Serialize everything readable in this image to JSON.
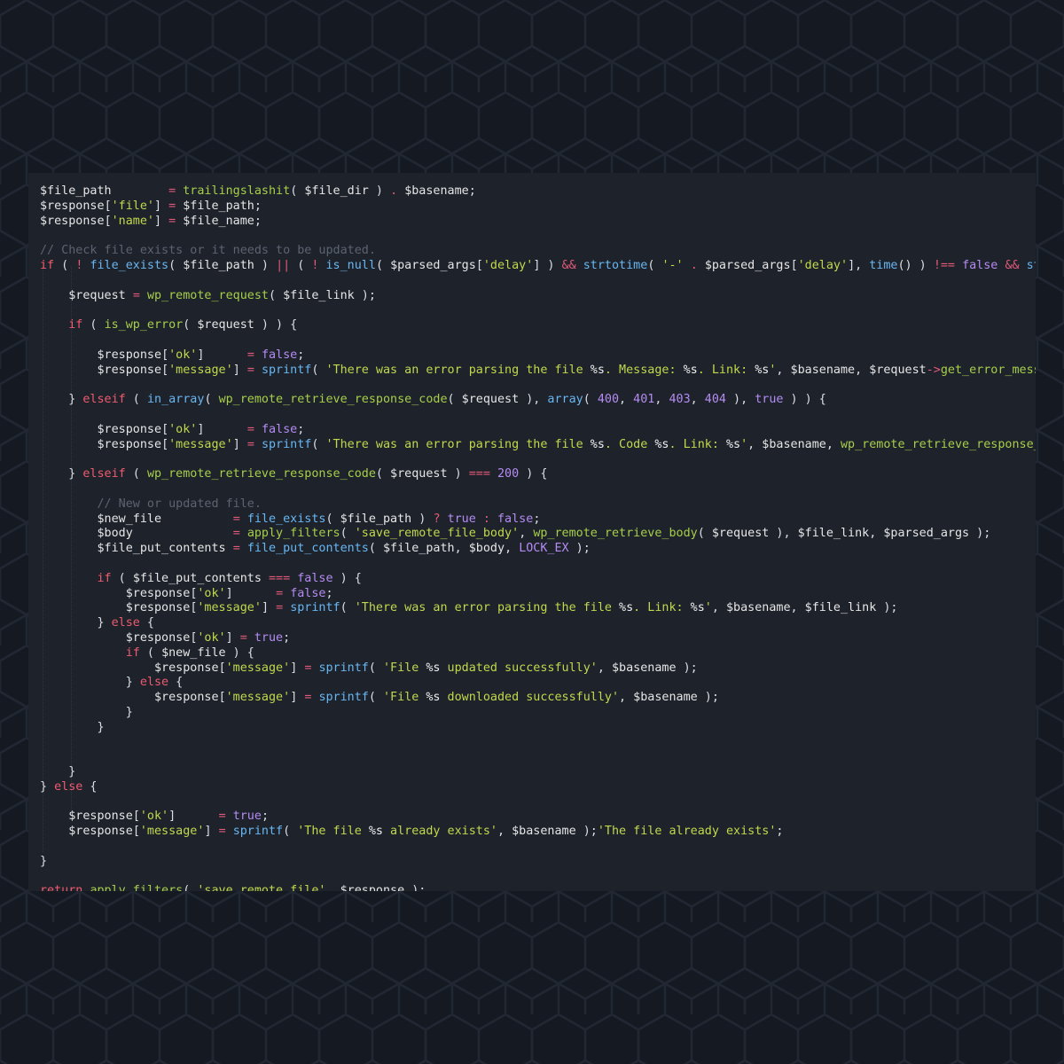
{
  "colors": {
    "background": "#151a22",
    "editor_background": "#1e222b",
    "hex_lines": "#212731",
    "string": "#c2d94c",
    "function": "#68b7f2",
    "keyword": "#ef5a6f",
    "operator": "#e35a79",
    "number": "#b48cf2",
    "comment": "#5c6370",
    "variable": "#e6e6e6"
  },
  "code_lines": [
    [
      [
        "var",
        "$file_path"
      ],
      [
        "txt",
        "        "
      ],
      [
        "op",
        "="
      ],
      [
        "txt",
        " "
      ],
      [
        "fnw",
        "trailingslashit"
      ],
      [
        "txt",
        "( "
      ],
      [
        "var",
        "$file_dir"
      ],
      [
        "txt",
        " ) "
      ],
      [
        "op",
        "."
      ],
      [
        "txt",
        " "
      ],
      [
        "var",
        "$basename"
      ],
      [
        "txt",
        ";"
      ]
    ],
    [
      [
        "var",
        "$response"
      ],
      [
        "txt",
        "["
      ],
      [
        "str",
        "'file'"
      ],
      [
        "txt",
        "] "
      ],
      [
        "op",
        "="
      ],
      [
        "txt",
        " "
      ],
      [
        "var",
        "$file_path"
      ],
      [
        "txt",
        ";"
      ]
    ],
    [
      [
        "var",
        "$response"
      ],
      [
        "txt",
        "["
      ],
      [
        "str",
        "'name'"
      ],
      [
        "txt",
        "] "
      ],
      [
        "op",
        "="
      ],
      [
        "txt",
        " "
      ],
      [
        "var",
        "$file_name"
      ],
      [
        "txt",
        ";"
      ]
    ],
    [],
    [
      [
        "com",
        "// Check file exists or it needs to be updated."
      ]
    ],
    [
      [
        "kw",
        "if"
      ],
      [
        "txt",
        " ( "
      ],
      [
        "op",
        "!"
      ],
      [
        "txt",
        " "
      ],
      [
        "fn",
        "file_exists"
      ],
      [
        "txt",
        "( "
      ],
      [
        "var",
        "$file_path"
      ],
      [
        "txt",
        " ) "
      ],
      [
        "op",
        "||"
      ],
      [
        "txt",
        " ( "
      ],
      [
        "op",
        "!"
      ],
      [
        "txt",
        " "
      ],
      [
        "fn",
        "is_null"
      ],
      [
        "txt",
        "( "
      ],
      [
        "var",
        "$parsed_args"
      ],
      [
        "txt",
        "["
      ],
      [
        "str",
        "'delay'"
      ],
      [
        "txt",
        "] ) "
      ],
      [
        "op",
        "&&"
      ],
      [
        "txt",
        " "
      ],
      [
        "fn",
        "strtotime"
      ],
      [
        "txt",
        "( "
      ],
      [
        "str",
        "'-'"
      ],
      [
        "txt",
        " "
      ],
      [
        "op",
        "."
      ],
      [
        "txt",
        " "
      ],
      [
        "var",
        "$parsed_args"
      ],
      [
        "txt",
        "["
      ],
      [
        "str",
        "'delay'"
      ],
      [
        "txt",
        "], "
      ],
      [
        "fn",
        "time"
      ],
      [
        "txt",
        "() ) "
      ],
      [
        "op",
        "!=="
      ],
      [
        "txt",
        " "
      ],
      [
        "bool",
        "false"
      ],
      [
        "txt",
        " "
      ],
      [
        "op",
        "&&"
      ],
      [
        "txt",
        " "
      ],
      [
        "fn",
        "str"
      ]
    ],
    [],
    [
      [
        "txt",
        "    "
      ],
      [
        "var",
        "$request"
      ],
      [
        "txt",
        " "
      ],
      [
        "op",
        "="
      ],
      [
        "txt",
        " "
      ],
      [
        "fnw",
        "wp_remote_request"
      ],
      [
        "txt",
        "( "
      ],
      [
        "var",
        "$file_link"
      ],
      [
        "txt",
        " );"
      ]
    ],
    [],
    [
      [
        "txt",
        "    "
      ],
      [
        "kw",
        "if"
      ],
      [
        "txt",
        " ( "
      ],
      [
        "fnw",
        "is_wp_error"
      ],
      [
        "txt",
        "( "
      ],
      [
        "var",
        "$request"
      ],
      [
        "txt",
        " ) ) {"
      ]
    ],
    [],
    [
      [
        "txt",
        "        "
      ],
      [
        "var",
        "$response"
      ],
      [
        "txt",
        "["
      ],
      [
        "str",
        "'ok'"
      ],
      [
        "txt",
        "]      "
      ],
      [
        "op",
        "="
      ],
      [
        "txt",
        " "
      ],
      [
        "bool",
        "false"
      ],
      [
        "txt",
        ";"
      ]
    ],
    [
      [
        "txt",
        "        "
      ],
      [
        "var",
        "$response"
      ],
      [
        "txt",
        "["
      ],
      [
        "str",
        "'message'"
      ],
      [
        "txt",
        "] "
      ],
      [
        "op",
        "="
      ],
      [
        "txt",
        " "
      ],
      [
        "fn",
        "sprintf"
      ],
      [
        "txt",
        "( "
      ],
      [
        "str",
        "'There was an error parsing the file "
      ],
      [
        "fmt",
        "%s"
      ],
      [
        "str",
        ". Message: "
      ],
      [
        "fmt",
        "%s"
      ],
      [
        "str",
        ". Link: "
      ],
      [
        "fmt",
        "%s"
      ],
      [
        "str",
        "'"
      ],
      [
        "txt",
        ", "
      ],
      [
        "var",
        "$basename"
      ],
      [
        "txt",
        ", "
      ],
      [
        "var",
        "$request"
      ],
      [
        "op",
        "->"
      ],
      [
        "fnw",
        "get_error_messa"
      ]
    ],
    [],
    [
      [
        "txt",
        "    } "
      ],
      [
        "kw",
        "elseif"
      ],
      [
        "txt",
        " ( "
      ],
      [
        "fn",
        "in_array"
      ],
      [
        "txt",
        "( "
      ],
      [
        "fnw",
        "wp_remote_retrieve_response_code"
      ],
      [
        "txt",
        "( "
      ],
      [
        "var",
        "$request"
      ],
      [
        "txt",
        " ), "
      ],
      [
        "fn",
        "array"
      ],
      [
        "txt",
        "( "
      ],
      [
        "num",
        "400"
      ],
      [
        "txt",
        ", "
      ],
      [
        "num",
        "401"
      ],
      [
        "txt",
        ", "
      ],
      [
        "num",
        "403"
      ],
      [
        "txt",
        ", "
      ],
      [
        "num",
        "404"
      ],
      [
        "txt",
        " ), "
      ],
      [
        "bool",
        "true"
      ],
      [
        "txt",
        " ) ) {"
      ]
    ],
    [],
    [
      [
        "txt",
        "        "
      ],
      [
        "var",
        "$response"
      ],
      [
        "txt",
        "["
      ],
      [
        "str",
        "'ok'"
      ],
      [
        "txt",
        "]      "
      ],
      [
        "op",
        "="
      ],
      [
        "txt",
        " "
      ],
      [
        "bool",
        "false"
      ],
      [
        "txt",
        ";"
      ]
    ],
    [
      [
        "txt",
        "        "
      ],
      [
        "var",
        "$response"
      ],
      [
        "txt",
        "["
      ],
      [
        "str",
        "'message'"
      ],
      [
        "txt",
        "] "
      ],
      [
        "op",
        "="
      ],
      [
        "txt",
        " "
      ],
      [
        "fn",
        "sprintf"
      ],
      [
        "txt",
        "( "
      ],
      [
        "str",
        "'There was an error parsing the file "
      ],
      [
        "fmt",
        "%s"
      ],
      [
        "str",
        ". Code "
      ],
      [
        "fmt",
        "%s"
      ],
      [
        "str",
        ". Link: "
      ],
      [
        "fmt",
        "%s"
      ],
      [
        "str",
        "'"
      ],
      [
        "txt",
        ", "
      ],
      [
        "var",
        "$basename"
      ],
      [
        "txt",
        ", "
      ],
      [
        "fnw",
        "wp_remote_retrieve_response_c"
      ]
    ],
    [],
    [
      [
        "txt",
        "    } "
      ],
      [
        "kw",
        "elseif"
      ],
      [
        "txt",
        " ( "
      ],
      [
        "fnw",
        "wp_remote_retrieve_response_code"
      ],
      [
        "txt",
        "( "
      ],
      [
        "var",
        "$request"
      ],
      [
        "txt",
        " ) "
      ],
      [
        "op",
        "==="
      ],
      [
        "txt",
        " "
      ],
      [
        "num",
        "200"
      ],
      [
        "txt",
        " ) {"
      ]
    ],
    [],
    [
      [
        "txt",
        "        "
      ],
      [
        "com",
        "// New or updated file."
      ]
    ],
    [
      [
        "txt",
        "        "
      ],
      [
        "var",
        "$new_file"
      ],
      [
        "txt",
        "          "
      ],
      [
        "op",
        "="
      ],
      [
        "txt",
        " "
      ],
      [
        "fn",
        "file_exists"
      ],
      [
        "txt",
        "( "
      ],
      [
        "var",
        "$file_path"
      ],
      [
        "txt",
        " ) "
      ],
      [
        "op",
        "?"
      ],
      [
        "txt",
        " "
      ],
      [
        "bool",
        "true"
      ],
      [
        "txt",
        " "
      ],
      [
        "op",
        ":"
      ],
      [
        "txt",
        " "
      ],
      [
        "bool",
        "false"
      ],
      [
        "txt",
        ";"
      ]
    ],
    [
      [
        "txt",
        "        "
      ],
      [
        "var",
        "$body"
      ],
      [
        "txt",
        "              "
      ],
      [
        "op",
        "="
      ],
      [
        "txt",
        " "
      ],
      [
        "fnw",
        "apply_filters"
      ],
      [
        "txt",
        "( "
      ],
      [
        "str",
        "'save_remote_file_body'"
      ],
      [
        "txt",
        ", "
      ],
      [
        "fnw",
        "wp_remote_retrieve_body"
      ],
      [
        "txt",
        "( "
      ],
      [
        "var",
        "$request"
      ],
      [
        "txt",
        " ), "
      ],
      [
        "var",
        "$file_link"
      ],
      [
        "txt",
        ", "
      ],
      [
        "var",
        "$parsed_args"
      ],
      [
        "txt",
        " );"
      ]
    ],
    [
      [
        "txt",
        "        "
      ],
      [
        "var",
        "$file_put_contents"
      ],
      [
        "txt",
        " "
      ],
      [
        "op",
        "="
      ],
      [
        "txt",
        " "
      ],
      [
        "fn",
        "file_put_contents"
      ],
      [
        "txt",
        "( "
      ],
      [
        "var",
        "$file_path"
      ],
      [
        "txt",
        ", "
      ],
      [
        "var",
        "$body"
      ],
      [
        "txt",
        ", "
      ],
      [
        "const",
        "LOCK_EX"
      ],
      [
        "txt",
        " );"
      ]
    ],
    [],
    [
      [
        "txt",
        "        "
      ],
      [
        "kw",
        "if"
      ],
      [
        "txt",
        " ( "
      ],
      [
        "var",
        "$file_put_contents"
      ],
      [
        "txt",
        " "
      ],
      [
        "op",
        "==="
      ],
      [
        "txt",
        " "
      ],
      [
        "bool",
        "false"
      ],
      [
        "txt",
        " ) {"
      ]
    ],
    [
      [
        "txt",
        "            "
      ],
      [
        "var",
        "$response"
      ],
      [
        "txt",
        "["
      ],
      [
        "str",
        "'ok'"
      ],
      [
        "txt",
        "]      "
      ],
      [
        "op",
        "="
      ],
      [
        "txt",
        " "
      ],
      [
        "bool",
        "false"
      ],
      [
        "txt",
        ";"
      ]
    ],
    [
      [
        "txt",
        "            "
      ],
      [
        "var",
        "$response"
      ],
      [
        "txt",
        "["
      ],
      [
        "str",
        "'message'"
      ],
      [
        "txt",
        "] "
      ],
      [
        "op",
        "="
      ],
      [
        "txt",
        " "
      ],
      [
        "fn",
        "sprintf"
      ],
      [
        "txt",
        "( "
      ],
      [
        "str",
        "'There was an error parsing the file "
      ],
      [
        "fmt",
        "%s"
      ],
      [
        "str",
        ". Link: "
      ],
      [
        "fmt",
        "%s"
      ],
      [
        "str",
        "'"
      ],
      [
        "txt",
        ", "
      ],
      [
        "var",
        "$basename"
      ],
      [
        "txt",
        ", "
      ],
      [
        "var",
        "$file_link"
      ],
      [
        "txt",
        " );"
      ]
    ],
    [
      [
        "txt",
        "        } "
      ],
      [
        "kw",
        "else"
      ],
      [
        "txt",
        " {"
      ]
    ],
    [
      [
        "txt",
        "            "
      ],
      [
        "var",
        "$response"
      ],
      [
        "txt",
        "["
      ],
      [
        "str",
        "'ok'"
      ],
      [
        "txt",
        "] "
      ],
      [
        "op",
        "="
      ],
      [
        "txt",
        " "
      ],
      [
        "bool",
        "true"
      ],
      [
        "txt",
        ";"
      ]
    ],
    [
      [
        "txt",
        "            "
      ],
      [
        "kw",
        "if"
      ],
      [
        "txt",
        " ( "
      ],
      [
        "var",
        "$new_file"
      ],
      [
        "txt",
        " ) {"
      ]
    ],
    [
      [
        "txt",
        "                "
      ],
      [
        "var",
        "$response"
      ],
      [
        "txt",
        "["
      ],
      [
        "str",
        "'message'"
      ],
      [
        "txt",
        "] "
      ],
      [
        "op",
        "="
      ],
      [
        "txt",
        " "
      ],
      [
        "fn",
        "sprintf"
      ],
      [
        "txt",
        "( "
      ],
      [
        "str",
        "'File "
      ],
      [
        "fmt",
        "%s"
      ],
      [
        "str",
        " updated successfully'"
      ],
      [
        "txt",
        ", "
      ],
      [
        "var",
        "$basename"
      ],
      [
        "txt",
        " );"
      ]
    ],
    [
      [
        "txt",
        "            } "
      ],
      [
        "kw",
        "else"
      ],
      [
        "txt",
        " {"
      ]
    ],
    [
      [
        "txt",
        "                "
      ],
      [
        "var",
        "$response"
      ],
      [
        "txt",
        "["
      ],
      [
        "str",
        "'message'"
      ],
      [
        "txt",
        "] "
      ],
      [
        "op",
        "="
      ],
      [
        "txt",
        " "
      ],
      [
        "fn",
        "sprintf"
      ],
      [
        "txt",
        "( "
      ],
      [
        "str",
        "'File "
      ],
      [
        "fmt",
        "%s"
      ],
      [
        "str",
        " downloaded successfully'"
      ],
      [
        "txt",
        ", "
      ],
      [
        "var",
        "$basename"
      ],
      [
        "txt",
        " );"
      ]
    ],
    [
      [
        "txt",
        "            }"
      ]
    ],
    [
      [
        "txt",
        "        }"
      ]
    ],
    [],
    [],
    [
      [
        "txt",
        "    }"
      ]
    ],
    [
      [
        "txt",
        "} "
      ],
      [
        "kw",
        "else"
      ],
      [
        "txt",
        " {"
      ]
    ],
    [],
    [
      [
        "txt",
        "    "
      ],
      [
        "var",
        "$response"
      ],
      [
        "txt",
        "["
      ],
      [
        "str",
        "'ok'"
      ],
      [
        "txt",
        "]      "
      ],
      [
        "op",
        "="
      ],
      [
        "txt",
        " "
      ],
      [
        "bool",
        "true"
      ],
      [
        "txt",
        ";"
      ]
    ],
    [
      [
        "txt",
        "    "
      ],
      [
        "var",
        "$response"
      ],
      [
        "txt",
        "["
      ],
      [
        "str",
        "'message'"
      ],
      [
        "txt",
        "] "
      ],
      [
        "op",
        "="
      ],
      [
        "txt",
        " "
      ],
      [
        "fn",
        "sprintf"
      ],
      [
        "txt",
        "( "
      ],
      [
        "str",
        "'The file "
      ],
      [
        "fmt",
        "%s"
      ],
      [
        "str",
        " already exists'"
      ],
      [
        "txt",
        ", "
      ],
      [
        "var",
        "$basename"
      ],
      [
        "txt",
        " );"
      ],
      [
        "str",
        "'The file already exists'"
      ],
      [
        "txt",
        ";"
      ]
    ],
    [],
    [
      [
        "txt",
        "}"
      ]
    ],
    [],
    [
      [
        "kw",
        "return"
      ],
      [
        "txt",
        " "
      ],
      [
        "fnw",
        "apply_filters"
      ],
      [
        "txt",
        "( "
      ],
      [
        "str",
        "'save_remote_file'"
      ],
      [
        "txt",
        ", "
      ],
      [
        "var",
        "$response"
      ],
      [
        "txt",
        " );"
      ]
    ]
  ]
}
